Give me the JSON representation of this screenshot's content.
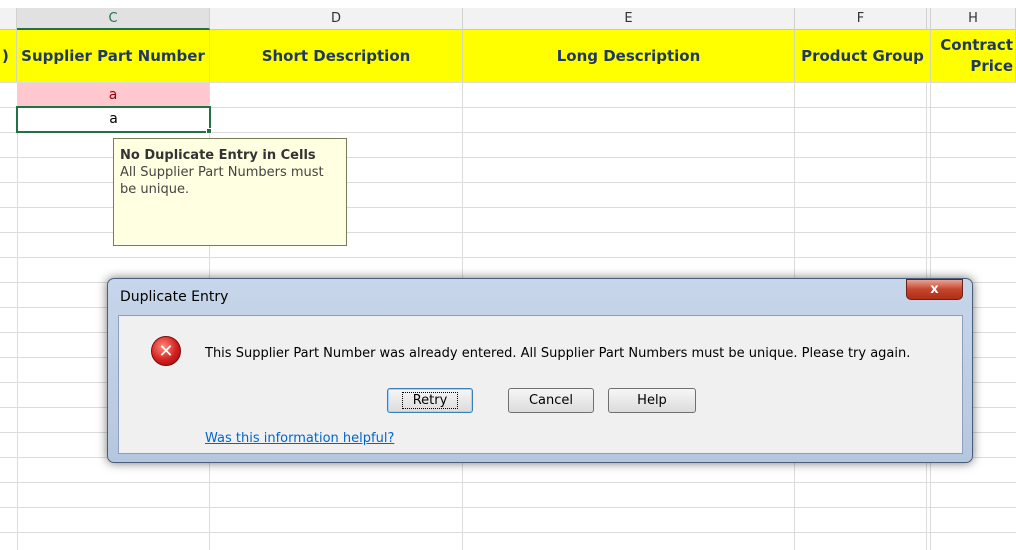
{
  "columns": {
    "c": "C",
    "d": "D",
    "e": "E",
    "f": "F",
    "h": "H"
  },
  "headers": {
    "partial": ")",
    "supplier_part_number": "Supplier Part Number",
    "short_description": "Short Description",
    "long_description": "Long Description",
    "product_group": "Product Group",
    "contract_price": "Contract Price"
  },
  "cells": {
    "c1": "a",
    "c2": "a"
  },
  "comment": {
    "title": "No Duplicate Entry in Cells",
    "body": "All Supplier Part Numbers must be unique."
  },
  "dialog": {
    "title": "Duplicate Entry",
    "close": "x",
    "message": "This Supplier Part Number was already entered.  All Supplier Part Numbers must be unique.  Please try again.",
    "retry": "Retry",
    "cancel": "Cancel",
    "help": "Help",
    "link": "Was this information helpful?",
    "icon": "error-icon"
  },
  "colors": {
    "header_fill": "#ffff00",
    "duplicate_fill": "#ffc7ce",
    "duplicate_text": "#9c0006",
    "selected": "#217346"
  }
}
